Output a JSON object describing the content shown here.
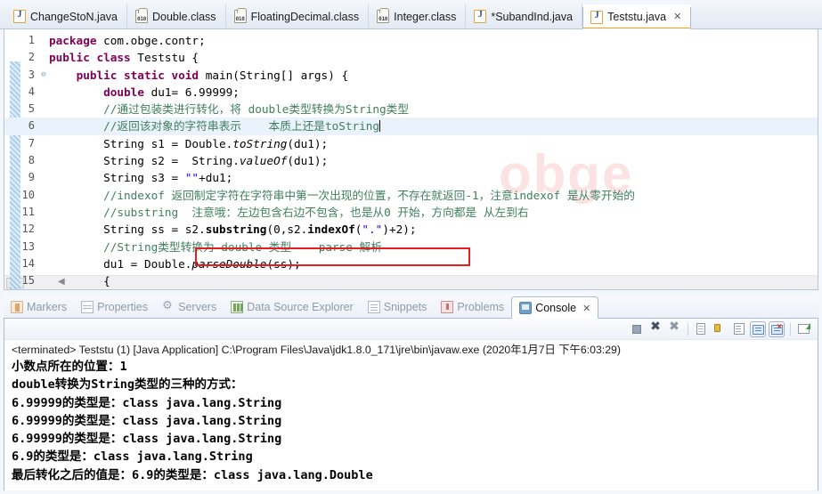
{
  "editor_tabs": [
    {
      "label": "ChangeStoN.java",
      "icon": "java-file-icon",
      "type": "java",
      "active": false,
      "closable": false
    },
    {
      "label": "Double.class",
      "icon": "class-file-icon",
      "type": "class",
      "active": false,
      "closable": false
    },
    {
      "label": "FloatingDecimal.class",
      "icon": "class-file-icon",
      "type": "class",
      "active": false,
      "closable": false
    },
    {
      "label": "Integer.class",
      "icon": "class-file-icon",
      "type": "class",
      "active": false,
      "closable": false
    },
    {
      "label": "*SubandInd.java",
      "icon": "java-file-icon",
      "type": "java",
      "active": false,
      "closable": false
    },
    {
      "label": "Teststu.java",
      "icon": "java-file-icon",
      "type": "java",
      "active": true,
      "closable": true,
      "close_glyph": "✕"
    }
  ],
  "editor": {
    "watermark": "obge",
    "highlighted_line": 6,
    "scroll_arrow": "◀",
    "lines": [
      {
        "num": "1",
        "fold": "",
        "text": "package com.obge.contr;"
      },
      {
        "num": "2",
        "fold": "",
        "text": "public class Teststu {"
      },
      {
        "num": "3",
        "fold": "⊖",
        "text": "    public static void main(String[] args) {"
      },
      {
        "num": "4",
        "fold": "",
        "text": "        double du1= 6.99999;"
      },
      {
        "num": "5",
        "fold": "",
        "text": "        //通过包装类进行转化，将 double类型转换为String类型"
      },
      {
        "num": "6",
        "fold": "",
        "text": "        //返回该对象的字符串表示    本质上还是toString"
      },
      {
        "num": "7",
        "fold": "",
        "text": "        String s1 = Double.toString(du1);"
      },
      {
        "num": "8",
        "fold": "",
        "text": "        String s2 =  String.valueOf(du1);"
      },
      {
        "num": "9",
        "fold": "",
        "text": "        String s3 = \"\"+du1;"
      },
      {
        "num": "10",
        "fold": "",
        "text": "        //indexof 返回制定字符在字符串中第一次出现的位置，不存在就返回-1，注意indexof 是从零开始的"
      },
      {
        "num": "11",
        "fold": "",
        "text": "        //substring  注意哦：左边包含右边不包含，也是从0 开始，方向都是 从左到右"
      },
      {
        "num": "12",
        "fold": "",
        "text": "        String ss = s2.substring(0,s2.indexOf(\".\")+2);"
      },
      {
        "num": "13",
        "fold": "",
        "text": "        //String类型转换为 double 类型    parse 解析"
      },
      {
        "num": "14",
        "fold": "",
        "text": "        du1 = Double.parseDouble(ss);"
      },
      {
        "num": "15",
        "fold": "",
        "text": "        {"
      }
    ],
    "annotation_box_color": "#e02020"
  },
  "view_tabs": [
    {
      "label": "Markers",
      "icon": "markers-icon",
      "active": false
    },
    {
      "label": "Properties",
      "icon": "properties-icon",
      "active": false
    },
    {
      "label": "Servers",
      "icon": "servers-icon",
      "active": false
    },
    {
      "label": "Data Source Explorer",
      "icon": "database-icon",
      "active": false
    },
    {
      "label": "Snippets",
      "icon": "snippets-icon",
      "active": false
    },
    {
      "label": "Problems",
      "icon": "problems-icon",
      "active": false
    },
    {
      "label": "Console",
      "icon": "console-icon",
      "active": true,
      "close_glyph": "✕"
    }
  ],
  "console_toolbar": [
    {
      "name": "terminate-button",
      "glyph": "stop",
      "framed": false
    },
    {
      "name": "remove-launch-button",
      "glyph": "x",
      "framed": false
    },
    {
      "name": "remove-all-launches-button",
      "glyph": "xx",
      "framed": false
    },
    {
      "name": "clear-console-button",
      "glyph": "page",
      "framed": false
    },
    {
      "name": "scroll-lock-button",
      "glyph": "lock",
      "framed": false
    },
    {
      "name": "word-wrap-button",
      "glyph": "scroll",
      "framed": false
    },
    {
      "name": "display-selected-console-button",
      "glyph": "disp",
      "framed": true
    },
    {
      "name": "open-console-button",
      "glyph": "disp-red",
      "framed": true
    },
    {
      "name": "pin-console-button",
      "glyph": "open",
      "framed": false
    }
  ],
  "console": {
    "terminated_line": "<terminated> Teststu (1) [Java Application] C:\\Program Files\\Java\\jdk1.8.0_171\\jre\\bin\\javaw.exe (2020年1月7日 下午6:03:29)",
    "output_lines": [
      "小数点所在的位置：1",
      "double转换为String类型的三种的方式：",
      "6.99999的类型是：class java.lang.String",
      "6.99999的类型是：class java.lang.String",
      "6.99999的类型是：class java.lang.String",
      "6.9的类型是：class java.lang.String",
      "最后转化之后的值是：6.9的类型是：class java.lang.Double"
    ]
  }
}
